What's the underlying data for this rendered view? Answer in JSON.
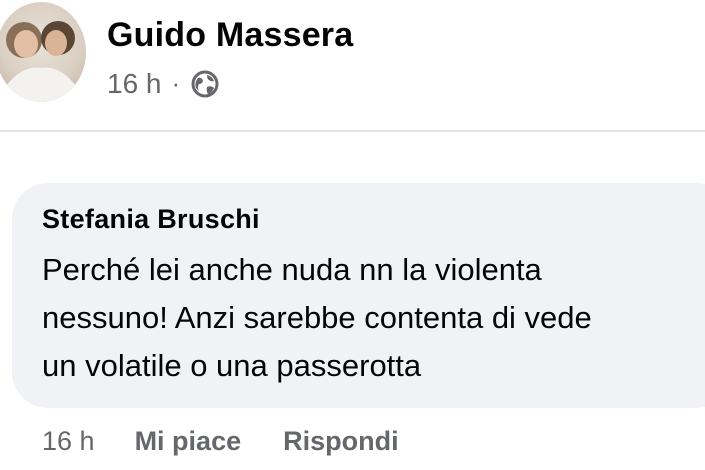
{
  "post": {
    "author": "Guido Massera",
    "time": "16 h",
    "separator": "·",
    "visibility_icon": "globe-icon"
  },
  "comment": {
    "author": "Stefania Bruschi",
    "text": "Perché lei anche nuda nn la violenta\nnessuno! Anzi sarebbe contenta di vede\nun volatile o una passerotta",
    "time": "16 h",
    "like_label": "Mi piace",
    "reply_label": "Rispondi"
  },
  "colors": {
    "text_primary": "#050505",
    "text_secondary": "#65676b",
    "bubble": "#f0f2f5",
    "divider": "#e4e6eb"
  }
}
